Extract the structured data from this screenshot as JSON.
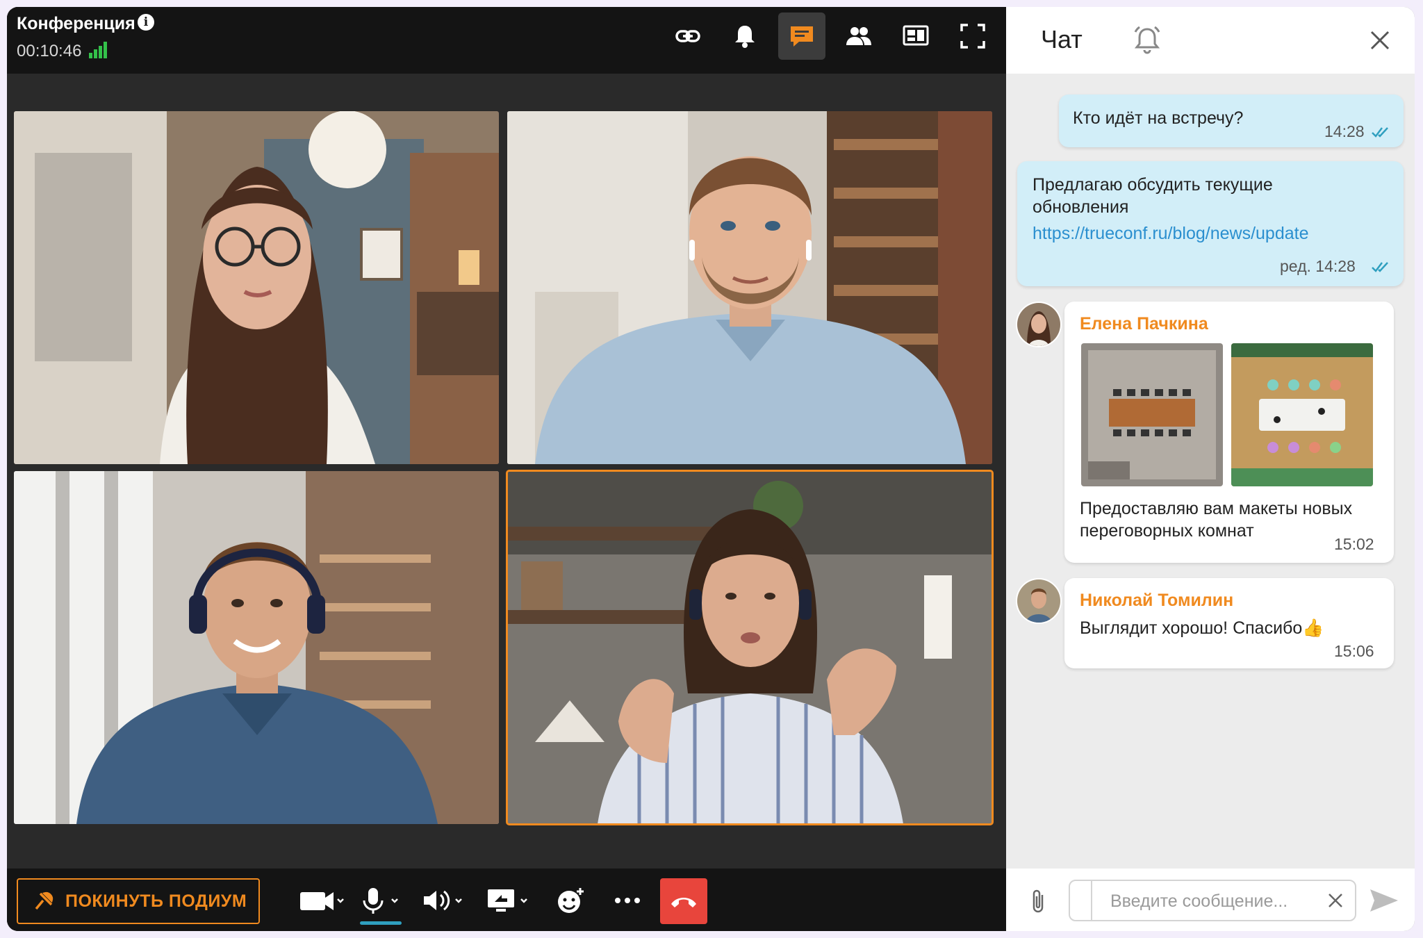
{
  "conference": {
    "title": "Конференция",
    "timer": "00:10:46",
    "toolbar_icons": [
      "link-icon",
      "bell-icon",
      "chat-icon",
      "participants-icon",
      "content-layout-icon",
      "fullscreen-icon"
    ],
    "active_toolbar": "chat-icon",
    "participants_tiles": [
      {
        "position": "top-left",
        "speaking": false
      },
      {
        "position": "top-right",
        "speaking": false
      },
      {
        "position": "bottom-left",
        "speaking": false
      },
      {
        "position": "bottom-right",
        "speaking": true
      }
    ],
    "leave_podium_label": "ПОКИНУТЬ ПОДИУМ",
    "controls": [
      "camera-icon",
      "microphone-icon",
      "speaker-icon",
      "screen-share-icon",
      "reactions-icon",
      "more-icon",
      "hangup-icon"
    ]
  },
  "chat": {
    "title": "Чат",
    "messages": [
      {
        "text": "Кто идёт на встречу?",
        "time": "14:28"
      },
      {
        "text_line1": "Предлагаю обсудить текущие",
        "text_line2": "обновления",
        "link": "https://trueconf.ru/blog/news/update",
        "time": "ред. 14:28"
      },
      {
        "sender": "Елена Пачкина",
        "text_line1": "Предоставляю вам макеты новых",
        "text_line2": "переговорных комнат",
        "time": "15:02"
      },
      {
        "sender": "Николай Томилин",
        "text": "Выглядит хорошо! Спасибо👍",
        "time": "15:06"
      }
    ],
    "input_placeholder": "Введите сообщение..."
  },
  "colors": {
    "accent": "#f08a1f",
    "hangup": "#e8453c",
    "own_bubble": "#d2eef8",
    "signal": "#33c14a",
    "link": "#2b8fcf"
  }
}
